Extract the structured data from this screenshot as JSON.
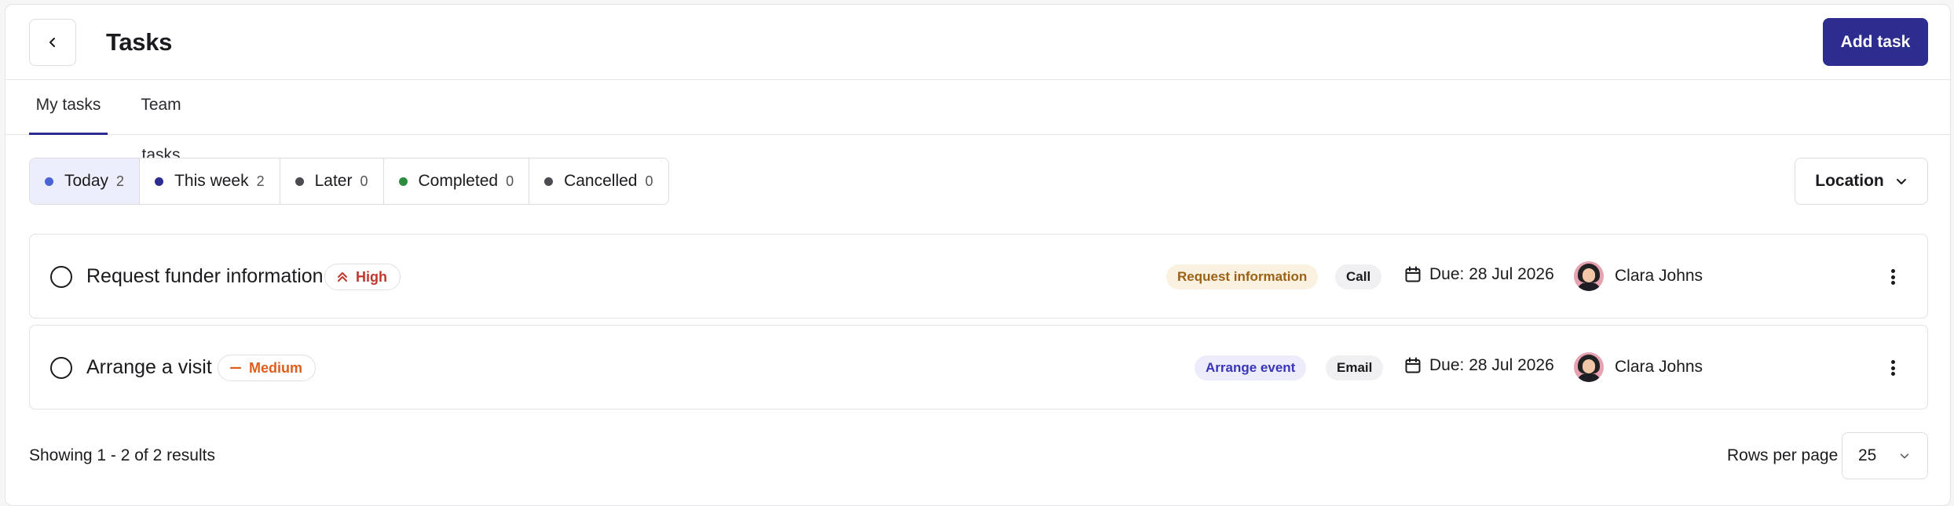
{
  "header": {
    "title": "Tasks",
    "add_button": "Add task"
  },
  "tabs": [
    {
      "label": "My tasks",
      "active": true
    },
    {
      "label": "Team tasks",
      "active": false
    }
  ],
  "filters": [
    {
      "label": "Today",
      "count": "2",
      "color": "#4a63d6",
      "active": true
    },
    {
      "label": "This week",
      "count": "2",
      "color": "#2d2c8f",
      "active": false
    },
    {
      "label": "Later",
      "count": "0",
      "color": "#4b4b52",
      "active": false
    },
    {
      "label": "Completed",
      "count": "0",
      "color": "#2e8b3e",
      "active": false
    },
    {
      "label": "Cancelled",
      "count": "0",
      "color": "#4b4b52",
      "active": false
    }
  ],
  "location": {
    "label": "Location"
  },
  "tasks": [
    {
      "title": "Request funder information",
      "priority": "High",
      "category": "Request information",
      "type": "Call",
      "due": "Due: 28 Jul 2026",
      "assignee": "Clara Johns"
    },
    {
      "title": "Arrange a visit",
      "priority": "Medium",
      "category": "Arrange event",
      "type": "Email",
      "due": "Due: 28 Jul 2026",
      "assignee": "Clara Johns"
    }
  ],
  "footer": {
    "results": "Showing 1 - 2 of 2 results",
    "rows_label": "Rows per page",
    "rows_value": "25"
  },
  "colors": {
    "primary": "#2d2c8f",
    "high": "#c2362c",
    "medium": "#dc5f1e"
  },
  "icons": [
    "chevron-left-icon",
    "chevron-up-double-icon",
    "minus-icon",
    "calendar-icon",
    "kebab-menu-icon",
    "chevron-down-icon"
  ]
}
